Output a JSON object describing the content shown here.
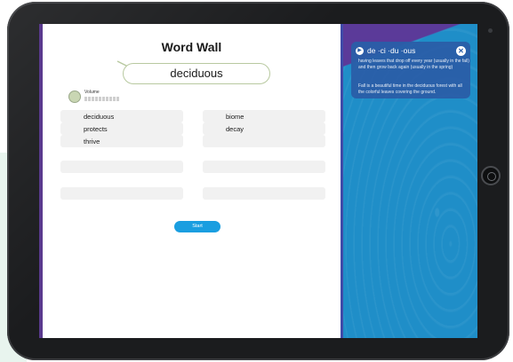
{
  "app": {
    "title": "Word Wall",
    "current_word": "deciduous",
    "volume_label": "Volume",
    "start_label": "Start"
  },
  "word_list": [
    "deciduous",
    "protects",
    "thrive",
    "biome",
    "decay"
  ],
  "definition_card": {
    "syllables": "de ·ci ·du ·ous",
    "definition": "having leaves that drop off every year (usually in the fall) and then grow back again (usually in the spring)",
    "example": "Fall is a beautiful time in the deciduous forest with all the colorful leaves covering the ground.",
    "close_icon": "close-icon",
    "speaker_icon": "speaker-icon"
  },
  "colors": {
    "accent": "#1a9ee0",
    "right_panel": "#1f8ec8",
    "card": "#2a5ea8",
    "purple": "#5b3a99"
  }
}
